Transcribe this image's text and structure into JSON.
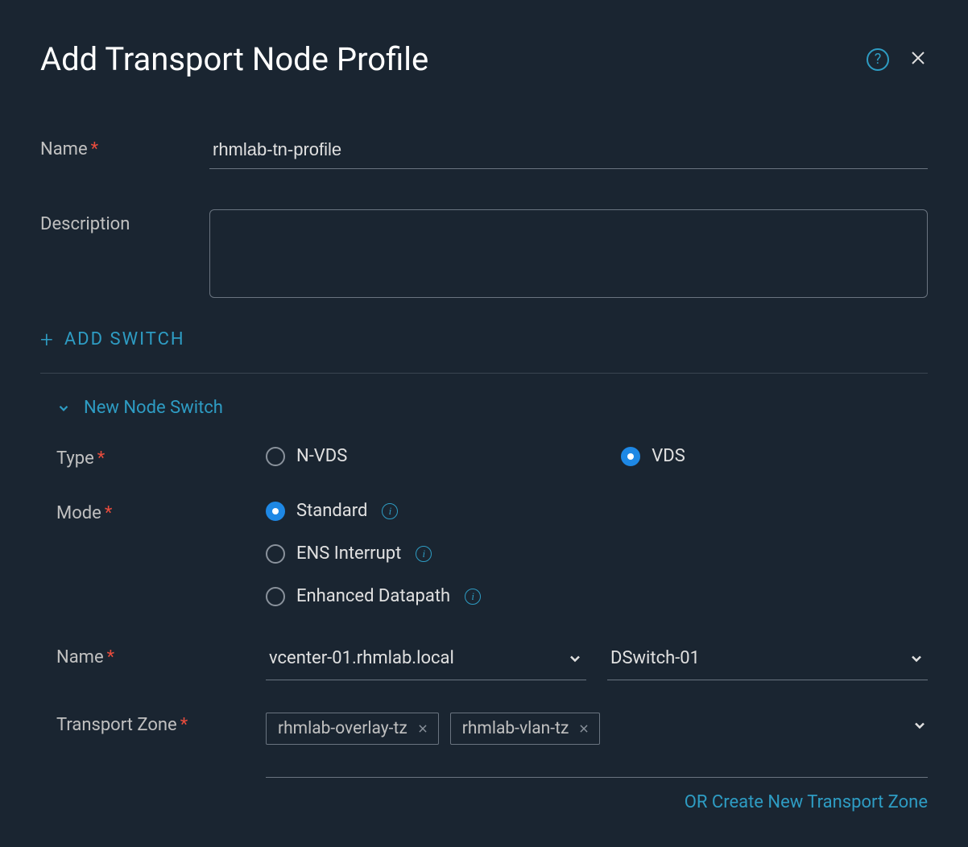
{
  "header": {
    "title": "Add Transport Node Profile"
  },
  "form": {
    "name_label": "Name",
    "name_value": "rhmlab-tn-profile",
    "description_label": "Description",
    "description_value": ""
  },
  "add_switch_label": "ADD SWITCH",
  "switch_section": {
    "title": "New Node Switch",
    "type_label": "Type",
    "type_options": {
      "nvds": "N-VDS",
      "vds": "VDS"
    },
    "mode_label": "Mode",
    "mode_options": {
      "standard": "Standard",
      "ens": "ENS Interrupt",
      "enhanced": "Enhanced Datapath"
    },
    "name_label": "Name",
    "vcenter_value": "vcenter-01.rhmlab.local",
    "dswitch_value": "DSwitch-01",
    "tz_label": "Transport Zone",
    "tz_chips": {
      "overlay": "rhmlab-overlay-tz",
      "vlan": "rhmlab-vlan-tz"
    },
    "create_link": "OR Create New Transport Zone"
  }
}
